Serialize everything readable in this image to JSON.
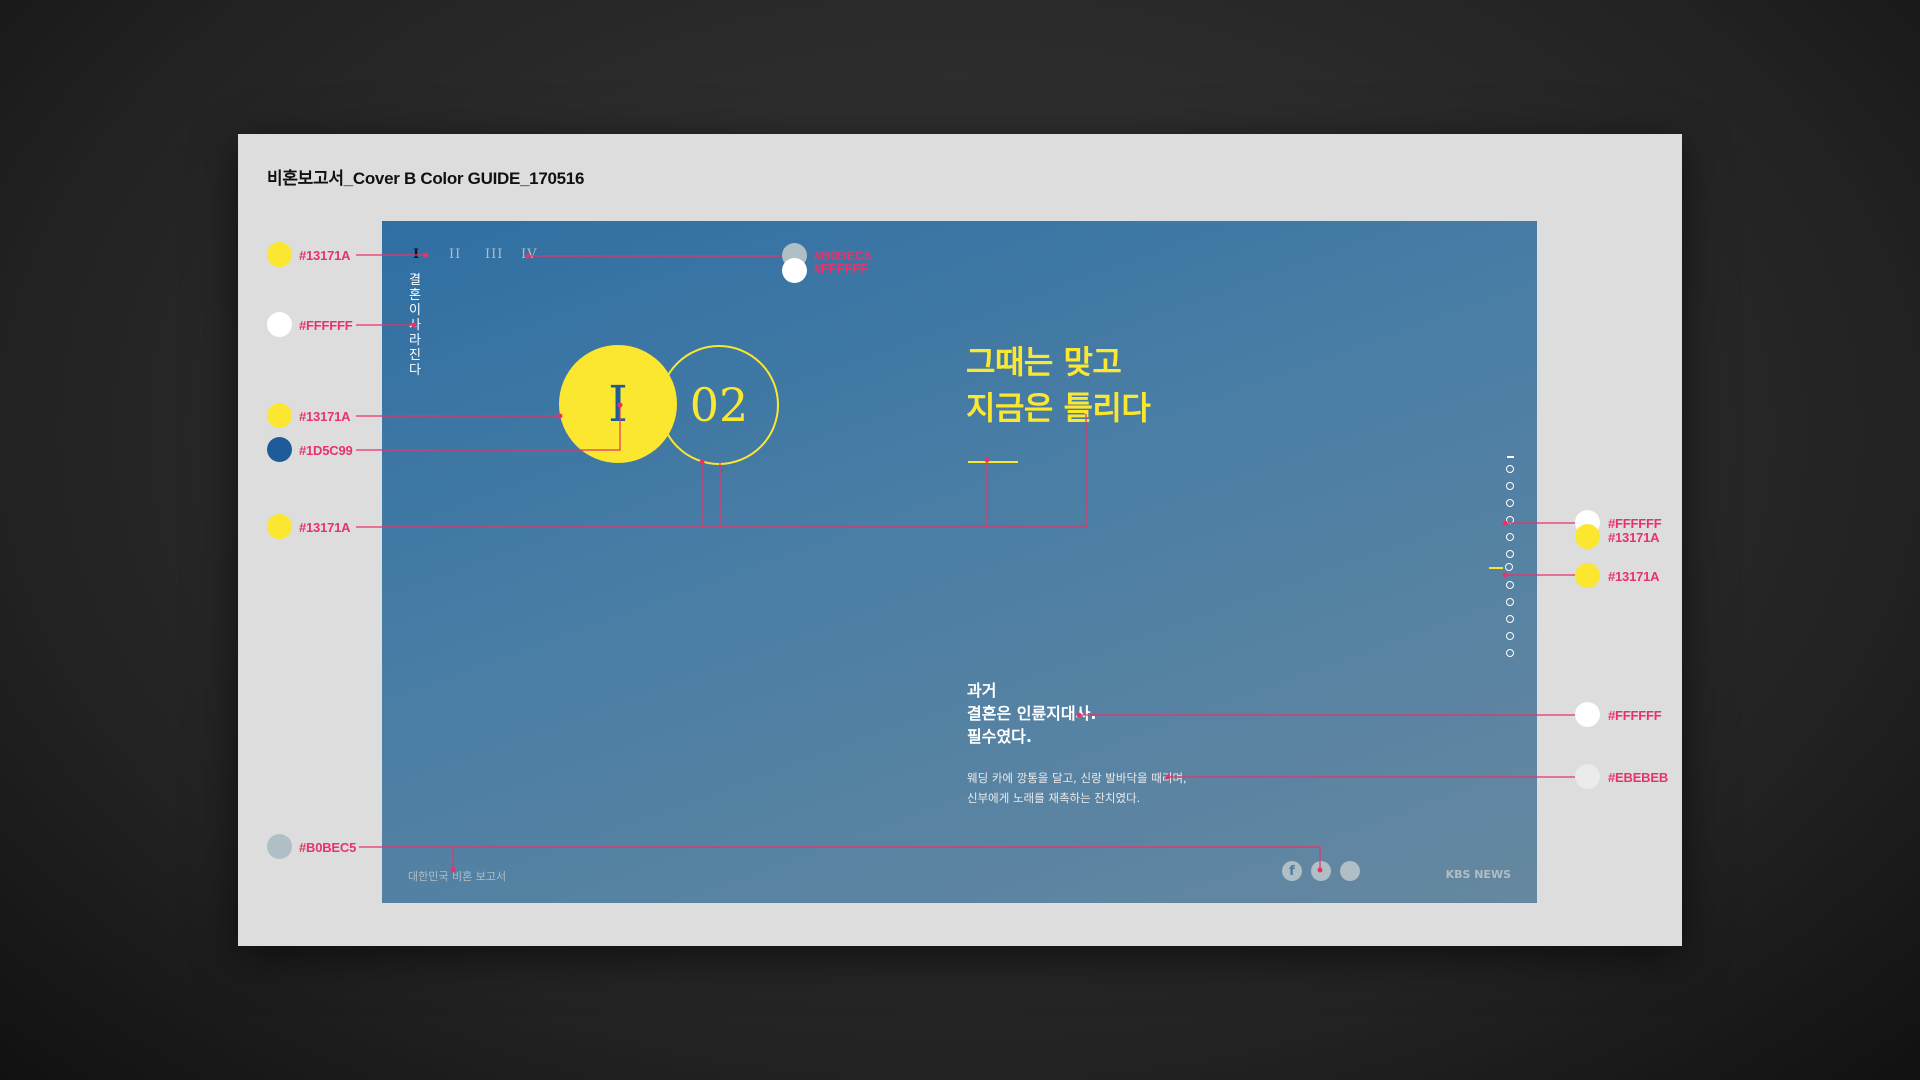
{
  "board": {
    "title": "비혼보고서_Cover B Color GUIDE_170516"
  },
  "slide": {
    "nav_items": [
      "I",
      "II",
      "III",
      "IV"
    ],
    "vertical_title": "결혼이 사라진다",
    "chapter_numeral": "I",
    "chapter_number": "02",
    "headline_line1": "그때는 맞고",
    "headline_line2": "지금은 틀리다",
    "body_title_line1": "과거",
    "body_title_line2": "결혼은 인륜지대사.",
    "body_title_line3": "필수였다.",
    "body_text_line1": "웨딩 카에 깡통을 달고, 신랑 발바닥을 때리며,",
    "body_text_line2": "신부에게 노래를 재촉하는 잔치였다.",
    "footer_label": "대한민국 비혼 보고서",
    "footer_brand": "KBS NEWS",
    "social_icons": [
      "facebook-icon",
      "twitter-icon",
      "share-icon"
    ],
    "facebook_glyph": "f",
    "background_gradient": [
      "#2f6fa3",
      "#6688a0"
    ]
  },
  "swatches": {
    "nav_active": {
      "label": "#13171A",
      "color": "#fbe72f"
    },
    "vertical_title": {
      "label": "#FFFFFF",
      "color": "#ffffff"
    },
    "circle_fill": {
      "label": "#13171A",
      "color": "#fbe72f"
    },
    "circle_numeral": {
      "label": "#1D5C99",
      "color": "#1d5c99"
    },
    "headline": {
      "label": "#13171A",
      "color": "#fbe72f"
    },
    "footer": {
      "label": "#B0BEC5",
      "color": "#b0bec5"
    },
    "nav_inactive": {
      "label": "#B0BEC5",
      "color": "#b0bec5"
    },
    "nav_inactive_white": {
      "label": "#FFFFFF",
      "color": "#ffffff"
    },
    "dots_white": {
      "label": "#FFFFFF",
      "color": "#ffffff"
    },
    "dots_yellow": {
      "label": "#13171A",
      "color": "#fbe72f"
    },
    "dots_active": {
      "label": "#13171A",
      "color": "#fbe72f"
    },
    "body_title": {
      "label": "#FFFFFF",
      "color": "#ffffff"
    },
    "body_text": {
      "label": "#EBEBEB",
      "color": "#ebebeb"
    }
  },
  "accent_color": "#e8336a"
}
